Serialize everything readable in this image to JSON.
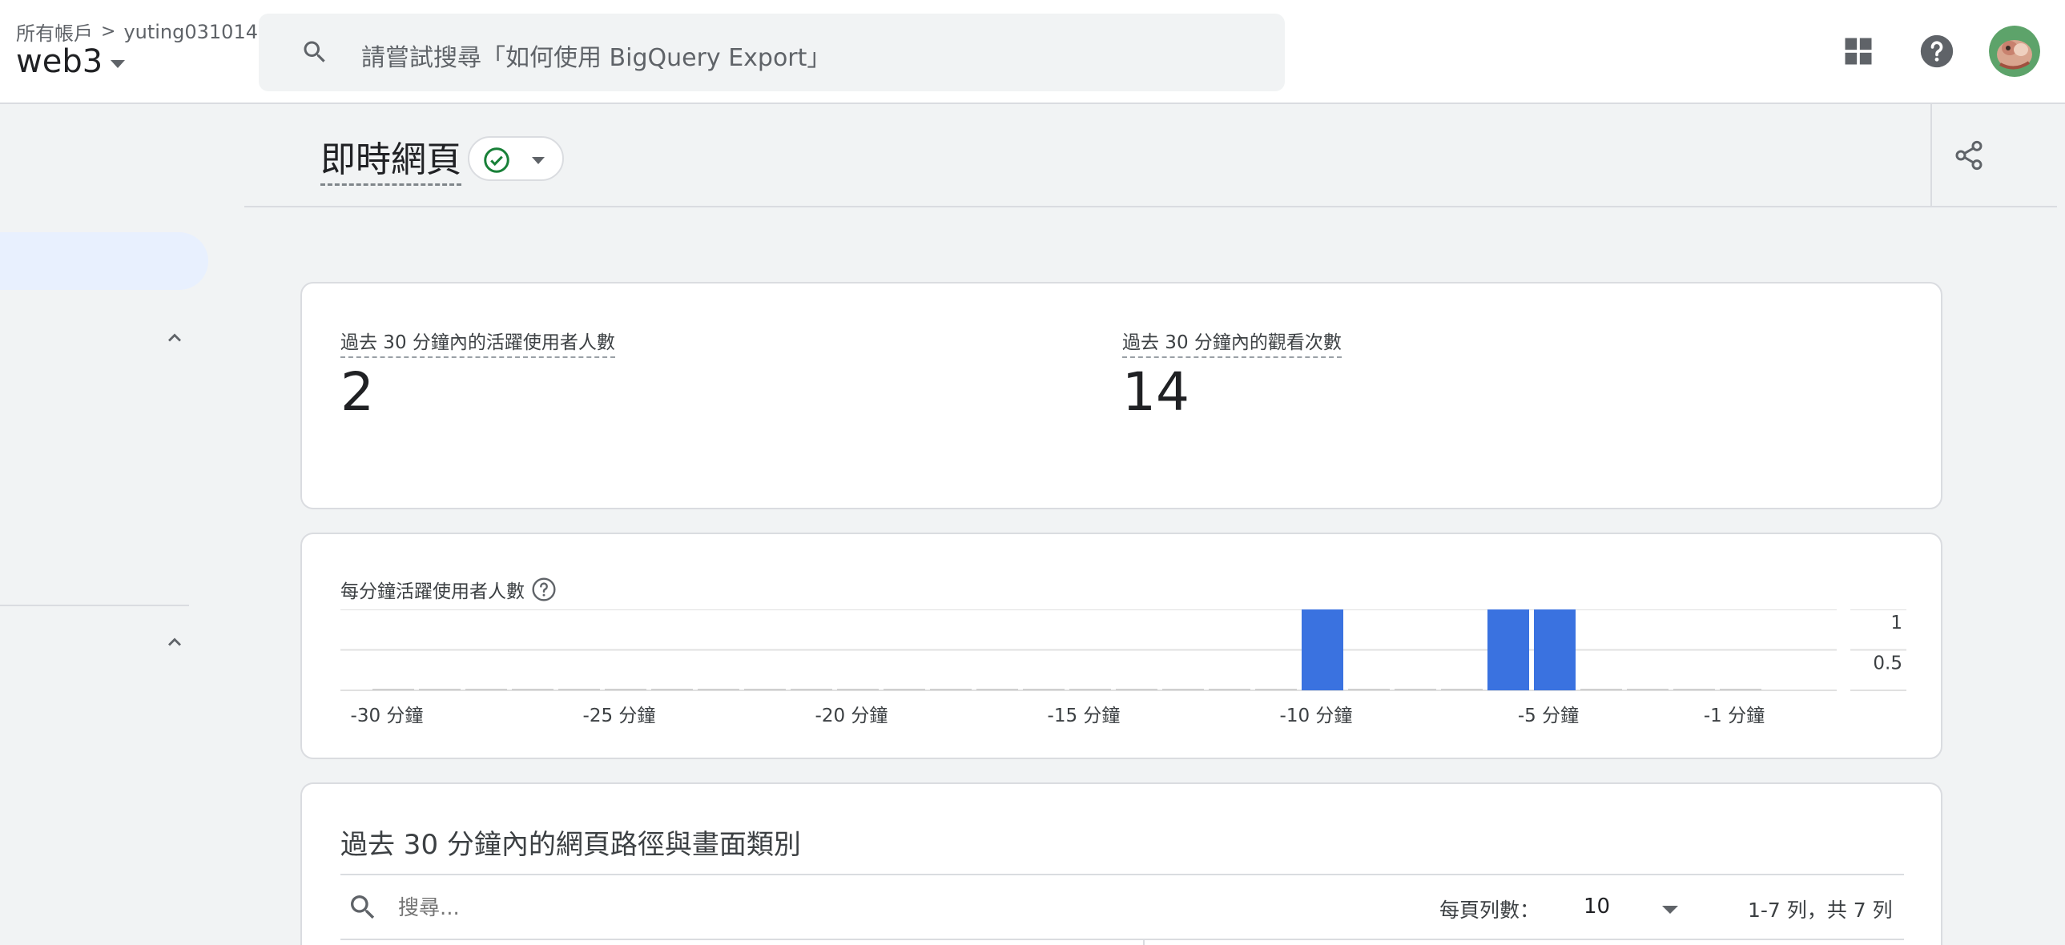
{
  "header": {
    "breadcrumb": {
      "root": "所有帳戶",
      "separator": ">",
      "account": "yuting031014"
    },
    "property": "web3",
    "search_placeholder": "請嘗試搜尋「如何使用 BigQuery Export」",
    "icons": [
      "search-icon",
      "apps-grid-icon",
      "help-icon",
      "avatar"
    ]
  },
  "page": {
    "title": "即時網頁",
    "status": "check-circle-icon"
  },
  "metrics": {
    "active_users_label": "過去 30 分鐘內的活躍使用者人數",
    "active_users_value": "2",
    "views_label": "過去 30 分鐘內的觀看次數",
    "views_value": "14"
  },
  "chart": {
    "title": "每分鐘活躍使用者人數"
  },
  "chart_data": {
    "type": "bar",
    "title": "每分鐘活躍使用者人數",
    "categories": [
      "-30 分鐘",
      "-29",
      "-28",
      "-27",
      "-26",
      "-25 分鐘",
      "-24",
      "-23",
      "-22",
      "-21",
      "-20 分鐘",
      "-19",
      "-18",
      "-17",
      "-16",
      "-15 分鐘",
      "-14",
      "-13",
      "-12",
      "-11",
      "-10 分鐘",
      "-9",
      "-8",
      "-7",
      "-6",
      "-5 分鐘",
      "-4",
      "-3",
      "-2",
      "-1 分鐘"
    ],
    "values": [
      0,
      0,
      0,
      0,
      0,
      0,
      0,
      0,
      0,
      0,
      0,
      0,
      0,
      0,
      0,
      0,
      0,
      0,
      0,
      0,
      1,
      0,
      0,
      0,
      1,
      1,
      0,
      0,
      0,
      0
    ],
    "x_tick_labels": [
      "-30 分鐘",
      "-25 分鐘",
      "-20 分鐘",
      "-15 分鐘",
      "-10 分鐘",
      "-5 分鐘",
      "-1 分鐘"
    ],
    "y_tick_labels": [
      "1",
      "0.5"
    ],
    "ylim": [
      0,
      1
    ],
    "color": "#3a72e0",
    "grid": true
  },
  "table": {
    "title": "過去 30 分鐘內的網頁路徑與畫面類別",
    "search_placeholder": "搜尋...",
    "rows_per_page_label": "每頁列數：",
    "rows_per_page_value": "10",
    "pagination": "1-7 列，共 7 列"
  }
}
